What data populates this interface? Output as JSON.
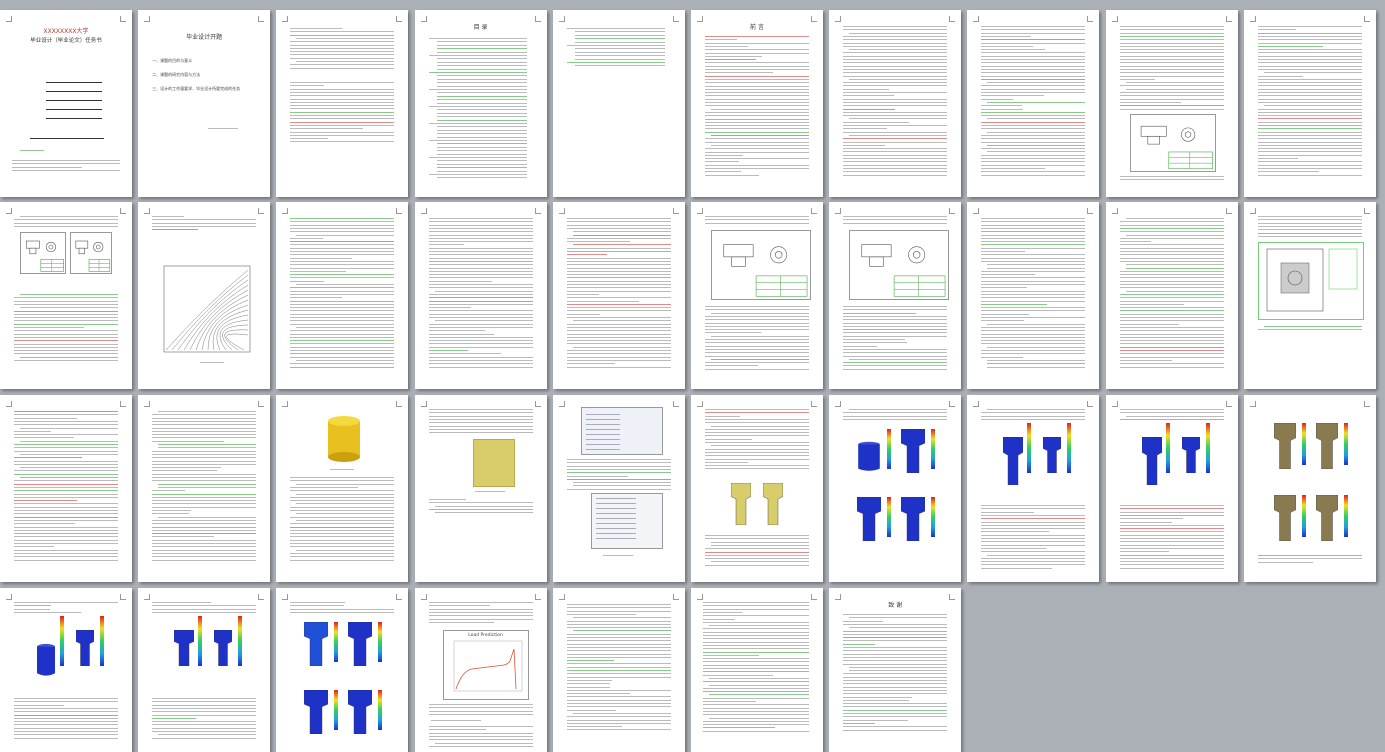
{
  "viewer": {
    "name": "document-thumbnail-view",
    "page_count": 36
  },
  "pages": [
    {
      "n": 1,
      "type": "cover",
      "title": "XXXXXXXX大学",
      "subtitle": "毕业设计（毕业论文）任务书"
    },
    {
      "n": 2,
      "type": "task",
      "title": "毕业设计开题",
      "items": [
        "一、课题的目的与意义",
        "二、课题的研究内容与方法",
        "三、设计的工作量要求、毕业设计所要完成的任务"
      ]
    },
    {
      "n": 3,
      "type": "abstract"
    },
    {
      "n": 4,
      "type": "toc",
      "title": "目    录"
    },
    {
      "n": 5,
      "type": "toc2"
    },
    {
      "n": 6,
      "type": "text",
      "heading": "前   言"
    },
    {
      "n": 7,
      "type": "text"
    },
    {
      "n": 8,
      "type": "text"
    },
    {
      "n": 9,
      "type": "text_drawing"
    },
    {
      "n": 10,
      "type": "text"
    },
    {
      "n": 11,
      "type": "text_figs"
    },
    {
      "n": 12,
      "type": "chart"
    },
    {
      "n": 13,
      "type": "text"
    },
    {
      "n": 14,
      "type": "text"
    },
    {
      "n": 15,
      "type": "text"
    },
    {
      "n": 16,
      "type": "drawing"
    },
    {
      "n": 17,
      "type": "drawing"
    },
    {
      "n": 18,
      "type": "text"
    },
    {
      "n": 19,
      "type": "text"
    },
    {
      "n": 20,
      "type": "mold"
    },
    {
      "n": 21,
      "type": "text"
    },
    {
      "n": 22,
      "type": "text"
    },
    {
      "n": 23,
      "type": "cylinder"
    },
    {
      "n": 24,
      "type": "plate"
    },
    {
      "n": 25,
      "type": "software"
    },
    {
      "n": 26,
      "type": "billets"
    },
    {
      "n": 27,
      "type": "sim4"
    },
    {
      "n": 28,
      "type": "sim2"
    },
    {
      "n": 29,
      "type": "sim2"
    },
    {
      "n": 30,
      "type": "simtex"
    },
    {
      "n": 31,
      "type": "sim2"
    },
    {
      "n": 32,
      "type": "sim2b"
    },
    {
      "n": 33,
      "type": "sim4b"
    },
    {
      "n": 34,
      "type": "load",
      "chart_title": "Load Prediction"
    },
    {
      "n": 35,
      "type": "text"
    },
    {
      "n": 36,
      "type": "refs"
    },
    {
      "n": 37,
      "type": "text",
      "heading": "致   谢"
    }
  ],
  "colors": {
    "background": "#abb0b7",
    "page": "#ffffff",
    "sim_blue": "#1e32c8",
    "cylinder": "#e8c020",
    "billet": "#d9cc6a"
  }
}
